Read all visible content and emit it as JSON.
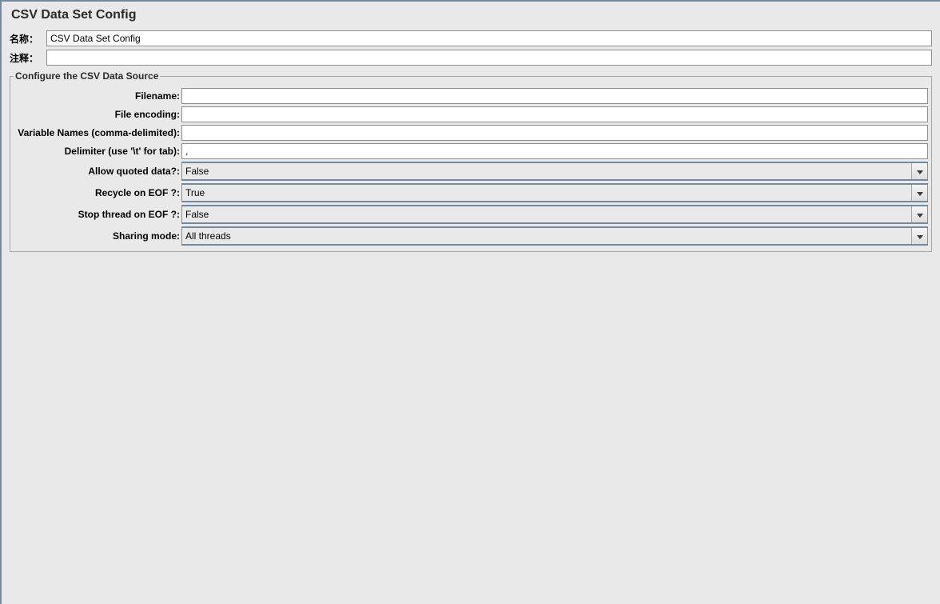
{
  "title": "CSV Data Set Config",
  "labels": {
    "name": "名称：",
    "comment": "注释："
  },
  "fields": {
    "name_value": "CSV Data Set Config",
    "comment_value": ""
  },
  "group": {
    "legend": "Configure the CSV Data Source",
    "rows": {
      "filename": {
        "label": "Filename:",
        "value": ""
      },
      "encoding": {
        "label": "File encoding:",
        "value": ""
      },
      "varnames": {
        "label": "Variable Names (comma-delimited):",
        "value": ""
      },
      "delimiter": {
        "label": "Delimiter (use '\\t' for tab):",
        "value": ","
      },
      "quoted": {
        "label": "Allow quoted data?:",
        "value": "False"
      },
      "recycle": {
        "label": "Recycle on EOF ?:",
        "value": "True"
      },
      "stop": {
        "label": "Stop thread on EOF ?:",
        "value": "False"
      },
      "sharing": {
        "label": "Sharing mode:",
        "value": "All threads"
      }
    }
  }
}
